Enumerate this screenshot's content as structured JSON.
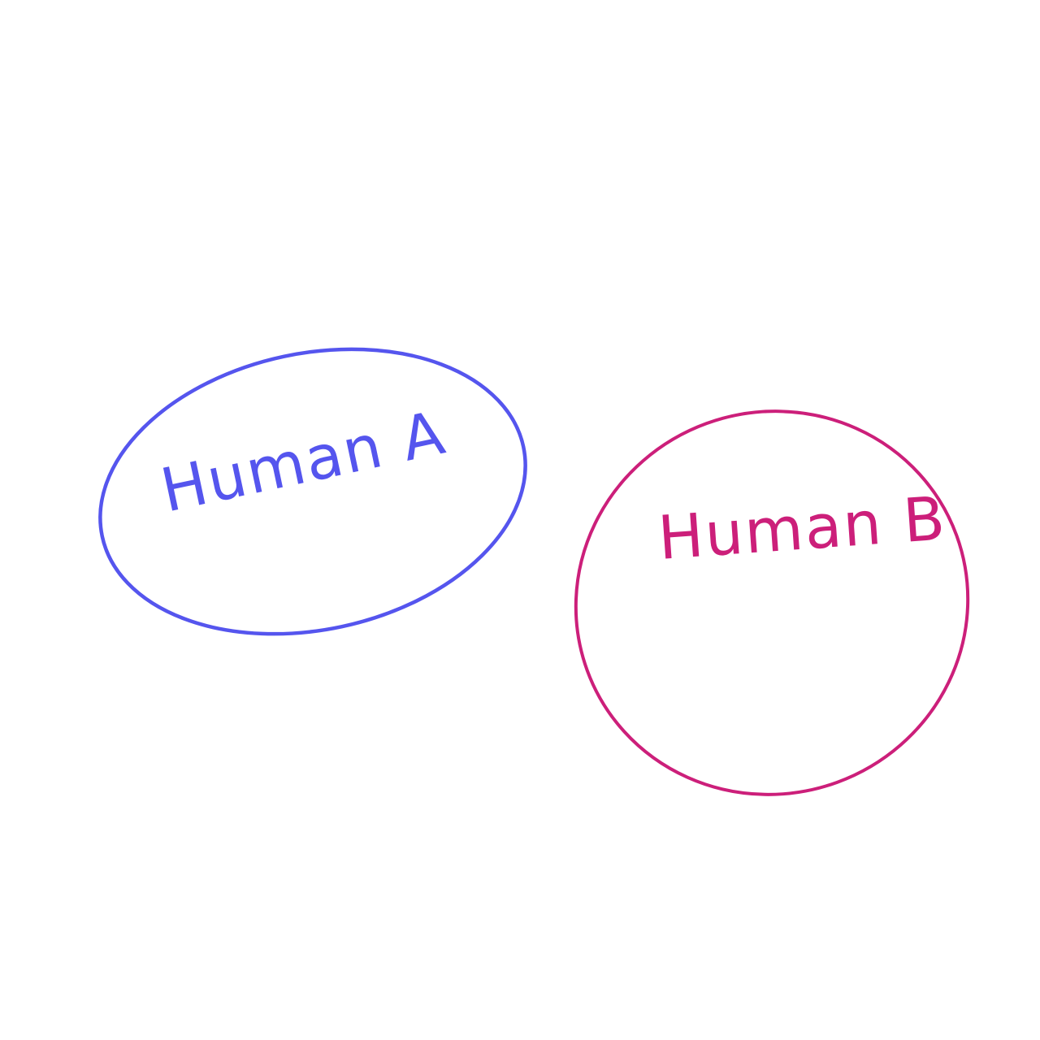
{
  "diagram": {
    "nodes": [
      {
        "id": "human-a",
        "label": "Human A",
        "color": "#5555ee"
      },
      {
        "id": "human-b",
        "label": "Human B",
        "color": "#cc1f7a"
      }
    ]
  }
}
